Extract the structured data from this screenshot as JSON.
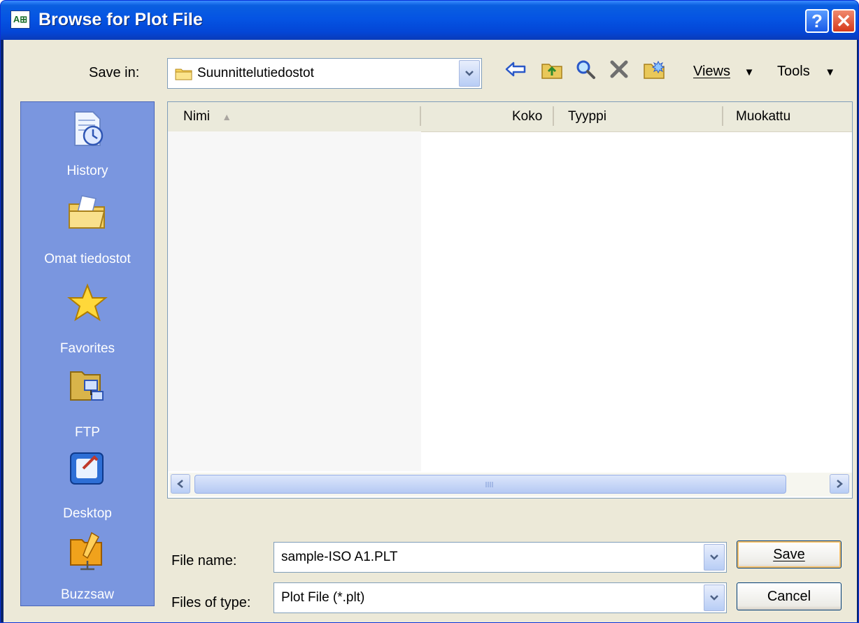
{
  "window": {
    "title": "Browse for Plot File",
    "app_icon_text": "A⊞",
    "help_glyph": "?",
    "close_glyph": "✕"
  },
  "save_in": {
    "label": "Save in:",
    "value": "Suunnittelutiedostot"
  },
  "toolbar": {
    "views_label": "Views",
    "tools_label": "Tools",
    "icons": [
      "back-arrow-icon",
      "up-folder-icon",
      "search-web-icon",
      "delete-icon",
      "new-folder-icon"
    ]
  },
  "places": [
    {
      "label": "History",
      "icon": "history-icon"
    },
    {
      "label": "Omat tiedostot",
      "icon": "my-documents-icon"
    },
    {
      "label": "Favorites",
      "icon": "favorites-star-icon"
    },
    {
      "label": "FTP",
      "icon": "ftp-icon"
    },
    {
      "label": "Desktop",
      "icon": "desktop-icon"
    },
    {
      "label": "Buzzsaw",
      "icon": "buzzsaw-icon"
    }
  ],
  "file_list": {
    "columns": {
      "name": "Nimi",
      "size": "Koko",
      "type": "Tyyppi",
      "modified": "Muokattu"
    },
    "rows": []
  },
  "file_name": {
    "label": "File name:",
    "value": "sample-ISO A1.PLT"
  },
  "file_type": {
    "label": "Files of type:",
    "value": "Plot File (*.plt)"
  },
  "buttons": {
    "save": "Save",
    "cancel": "Cancel"
  },
  "colors": {
    "titlebar": "#0554e3",
    "places_bg": "#7a96df",
    "dialog_bg": "#ece9d8"
  }
}
